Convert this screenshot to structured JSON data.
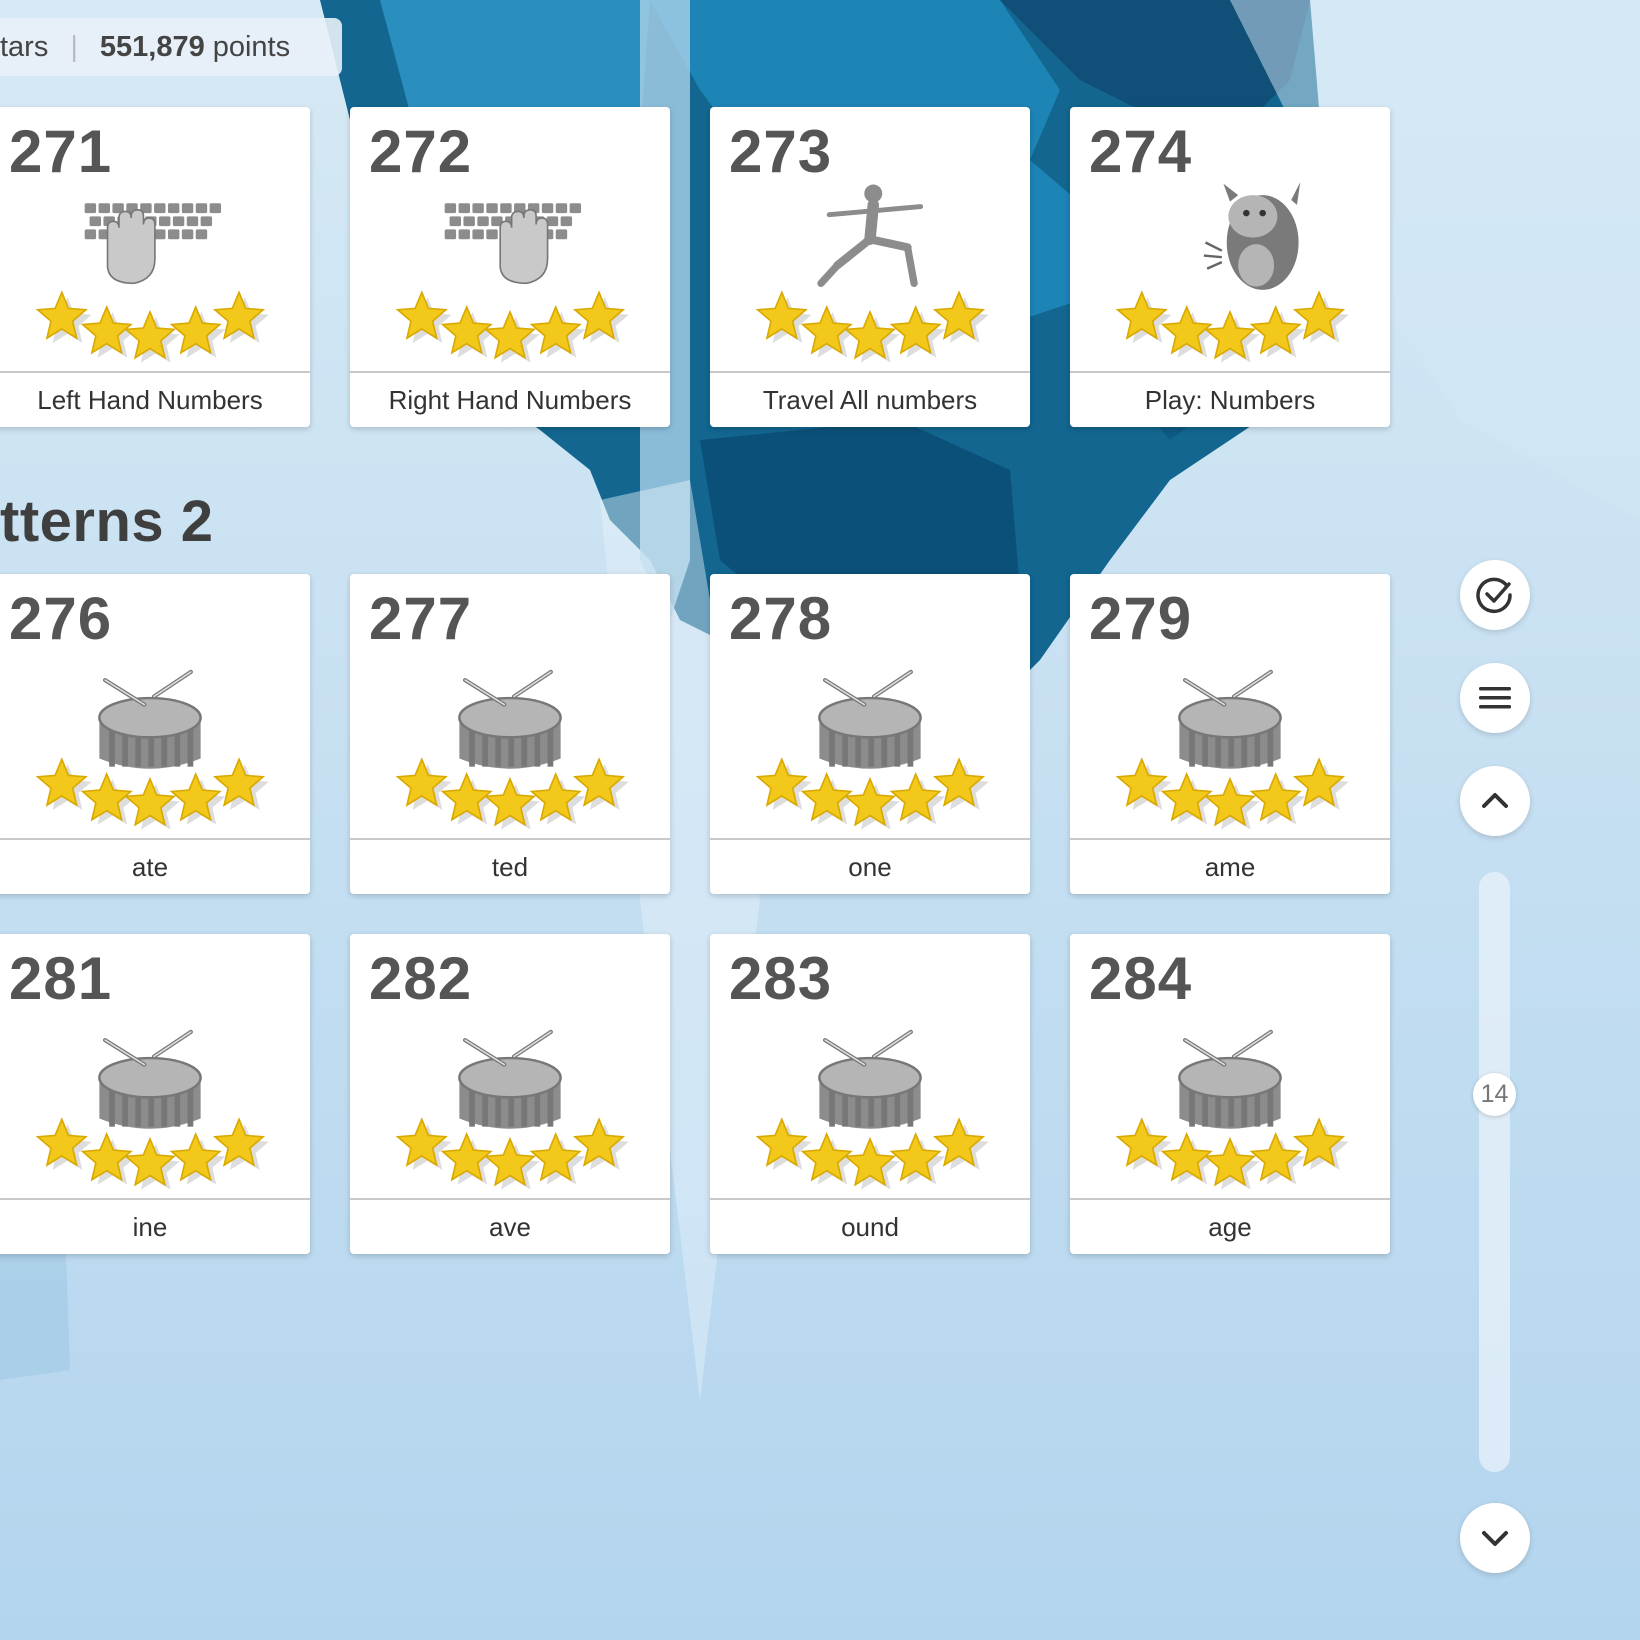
{
  "stats": {
    "stars_fragment": "tars",
    "separator": "|",
    "points_value": "551,879",
    "points_label": "points"
  },
  "section": {
    "title_fragment": "tterns 2"
  },
  "lessons": [
    {
      "number": "271",
      "label": "Left Hand Numbers",
      "icon": "left-hand-keyboard-icon",
      "stars": 5
    },
    {
      "number": "272",
      "label": "Right Hand Numbers",
      "icon": "right-hand-keyboard-icon",
      "stars": 5
    },
    {
      "number": "273",
      "label": "Travel All numbers",
      "icon": "runner-icon",
      "stars": 5
    },
    {
      "number": "274",
      "label": "Play: Numbers",
      "icon": "monster-icon",
      "stars": 5
    },
    {
      "number": "276",
      "label": "ate",
      "icon": "drum-icon",
      "stars": 5
    },
    {
      "number": "277",
      "label": "ted",
      "icon": "drum-icon",
      "stars": 5
    },
    {
      "number": "278",
      "label": "one",
      "icon": "drum-icon",
      "stars": 5
    },
    {
      "number": "279",
      "label": "ame",
      "icon": "drum-icon",
      "stars": 5
    },
    {
      "number": "281",
      "label": "ine",
      "icon": "drum-icon",
      "stars": 5
    },
    {
      "number": "282",
      "label": "ave",
      "icon": "drum-icon",
      "stars": 5
    },
    {
      "number": "283",
      "label": "ound",
      "icon": "drum-icon",
      "stars": 5
    },
    {
      "number": "284",
      "label": "age",
      "icon": "drum-icon",
      "stars": 5
    }
  ],
  "controls": {
    "buttons": [
      "checkmark-circle-icon",
      "menu-icon",
      "chevron-up-icon",
      "chevron-down-icon"
    ],
    "scroll_value": "14"
  },
  "colors": {
    "star": "#f2c81a",
    "icon_gray": "#8c8c8c",
    "card_bg": "#ffffff",
    "text_dark": "#3f3f3f",
    "crystal_dark": "#0d5e87",
    "crystal_mid": "#1a7fb0"
  }
}
